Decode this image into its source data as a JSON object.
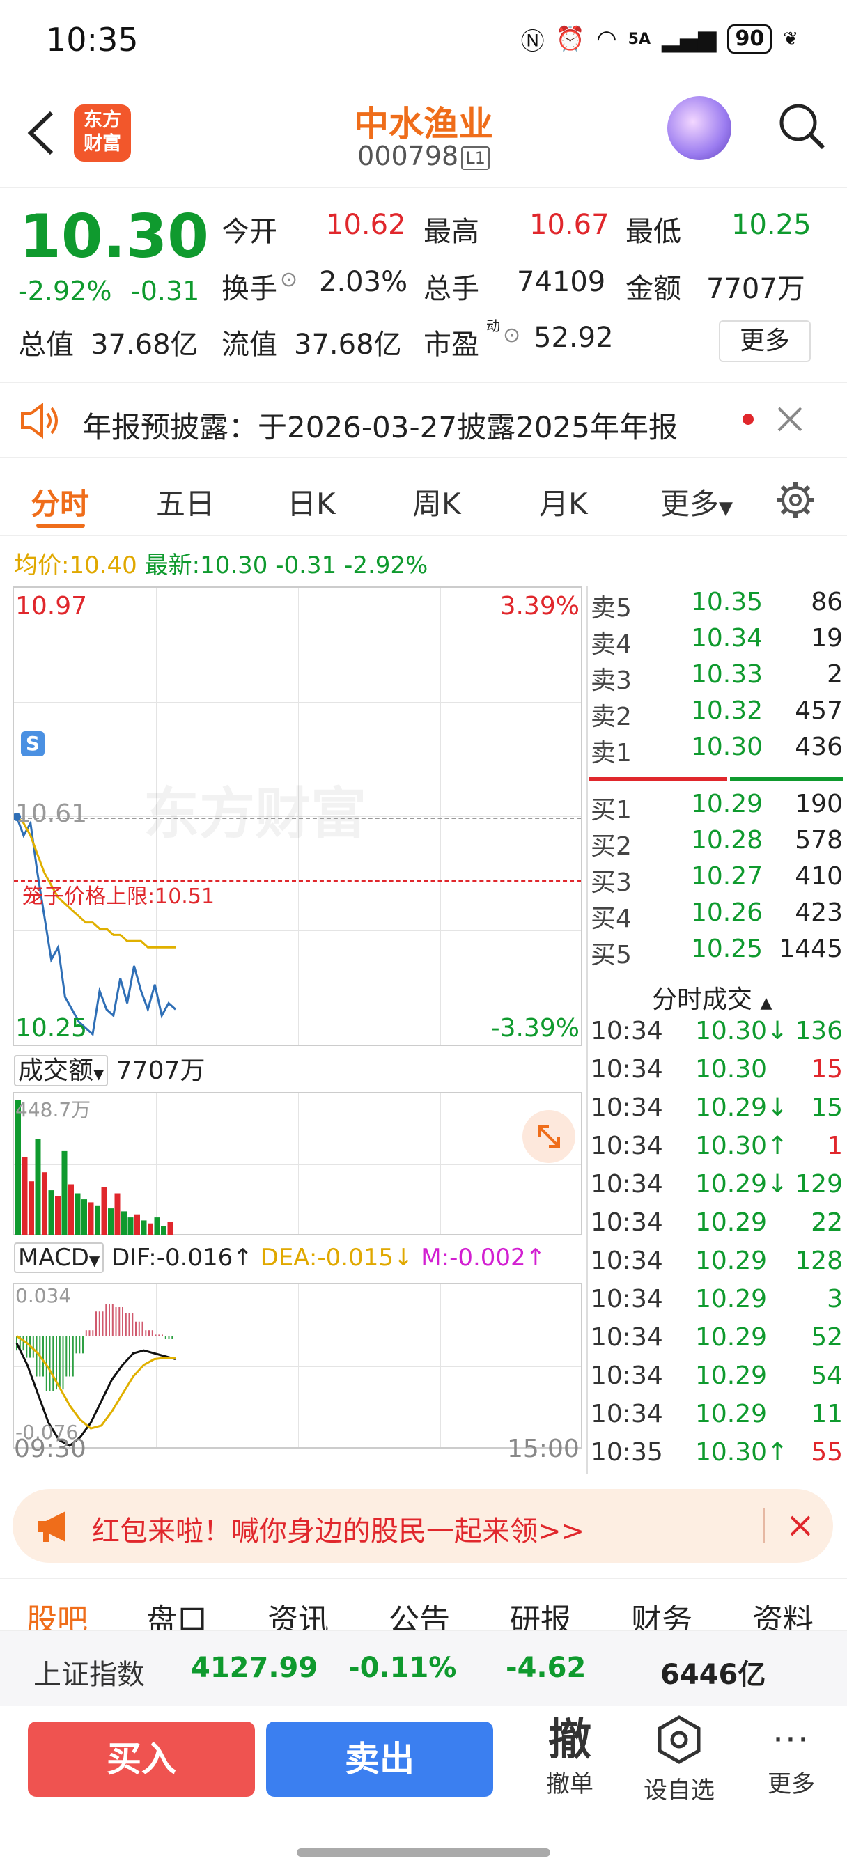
{
  "status": {
    "time": "10:35",
    "network": "5A",
    "battery": "90"
  },
  "header": {
    "logo": "东方财富",
    "name": "中水渔业",
    "code": "000798",
    "level": "L1"
  },
  "quote": {
    "price": "10.30",
    "change_pct": "-2.92%",
    "change": "-0.31",
    "open_label": "今开",
    "open": "10.62",
    "high_label": "最高",
    "high": "10.67",
    "low_label": "最低",
    "low": "10.25",
    "turnover_label": "换手",
    "turnover": "2.03%",
    "volume_label": "总手",
    "volume": "74109",
    "amount_label": "金额",
    "amount": "7707万",
    "mktcap_label": "总值",
    "mktcap": "37.68亿",
    "float_label": "流值",
    "float": "37.68亿",
    "pe_label": "市盈",
    "pe_sup": "动",
    "pe": "52.92",
    "more": "更多"
  },
  "notice": {
    "text": "年报预披露：于2026-03-27披露2025年年报"
  },
  "tabs": [
    "分时",
    "五日",
    "日K",
    "周K",
    "月K",
    "更多"
  ],
  "avg_line": {
    "avg_label": "均价:",
    "avg": "10.40",
    "latest_label": "最新:",
    "latest": "10.30",
    "change": "-0.31",
    "change_pct": "-2.92%"
  },
  "chart": {
    "price_max": "10.97",
    "price_min": "10.25",
    "pct_max": "3.39%",
    "pct_min": "-3.39%",
    "prev_close": "10.61",
    "cage_limit": "笼子价格上限:10.51",
    "watermark": "东方财富",
    "marker": "S",
    "vol_label": "成交额",
    "vol_value": "7707万",
    "vol_max": "448.7万",
    "macd_label": "MACD",
    "dif": "DIF:-0.016↑",
    "dea": "DEA:-0.015↓",
    "m": "M:-0.002↑",
    "macd_max": "0.034",
    "macd_min": "-0.076",
    "time_start": "09:30",
    "time_end": "15:00"
  },
  "chart_data": {
    "type": "line",
    "title": "",
    "ylim": [
      10.25,
      10.97
    ],
    "series": [
      {
        "name": "最新",
        "color": "#2f6fb6",
        "values": [
          10.61,
          10.58,
          10.6,
          10.52,
          10.45,
          10.38,
          10.4,
          10.32,
          10.3,
          10.28,
          10.27,
          10.26,
          10.33,
          10.3,
          10.29,
          10.35,
          10.31,
          10.37,
          10.33,
          10.3,
          10.34,
          10.29,
          10.31,
          10.3
        ]
      },
      {
        "name": "均价",
        "color": "#e0b000",
        "values": [
          10.61,
          10.6,
          10.58,
          10.55,
          10.52,
          10.5,
          10.48,
          10.47,
          10.46,
          10.45,
          10.44,
          10.44,
          10.43,
          10.43,
          10.42,
          10.42,
          10.41,
          10.41,
          10.41,
          10.4,
          10.4,
          10.4,
          10.4,
          10.4
        ]
      }
    ],
    "volume_unit": "万",
    "volume": [
      448.7,
      260,
      180,
      320,
      210,
      150,
      130,
      280,
      170,
      140,
      120,
      110,
      100,
      160,
      90,
      140,
      80,
      60,
      70,
      50,
      40,
      60,
      30,
      45
    ],
    "volume_up": [
      false,
      true,
      true,
      false,
      true,
      false,
      true,
      false,
      true,
      false,
      false,
      true,
      false,
      true,
      false,
      true,
      false,
      false,
      true,
      false,
      true,
      false,
      false,
      true
    ],
    "macd_dif": [
      -0.005,
      -0.02,
      -0.04,
      -0.06,
      -0.072,
      -0.076,
      -0.07,
      -0.06,
      -0.045,
      -0.03,
      -0.02,
      -0.012,
      -0.01,
      -0.012,
      -0.014,
      -0.016
    ],
    "macd_dea": [
      0.0,
      -0.005,
      -0.012,
      -0.022,
      -0.035,
      -0.048,
      -0.058,
      -0.064,
      -0.062,
      -0.052,
      -0.04,
      -0.028,
      -0.02,
      -0.016,
      -0.015,
      -0.015
    ],
    "macd_hist": [
      -0.01,
      -0.015,
      -0.028,
      -0.038,
      -0.037,
      -0.028,
      -0.012,
      0.004,
      0.017,
      0.022,
      0.02,
      0.016,
      0.01,
      0.004,
      0.001,
      -0.002
    ]
  },
  "orderbook": {
    "asks": [
      {
        "label": "卖5",
        "price": "10.35",
        "vol": "86"
      },
      {
        "label": "卖4",
        "price": "10.34",
        "vol": "19"
      },
      {
        "label": "卖3",
        "price": "10.33",
        "vol": "2"
      },
      {
        "label": "卖2",
        "price": "10.32",
        "vol": "457"
      },
      {
        "label": "卖1",
        "price": "10.30",
        "vol": "436"
      }
    ],
    "bids": [
      {
        "label": "买1",
        "price": "10.29",
        "vol": "190"
      },
      {
        "label": "买2",
        "price": "10.28",
        "vol": "578"
      },
      {
        "label": "买3",
        "price": "10.27",
        "vol": "410"
      },
      {
        "label": "买4",
        "price": "10.26",
        "vol": "423"
      },
      {
        "label": "买5",
        "price": "10.25",
        "vol": "1445"
      }
    ],
    "ask_ratio": 0.55
  },
  "trades": {
    "title": "分时成交",
    "rows": [
      {
        "time": "10:34",
        "price": "10.30↓",
        "vol": "136",
        "pc": "green",
        "vc": "green"
      },
      {
        "time": "10:34",
        "price": "10.30",
        "vol": "15",
        "pc": "green",
        "vc": "red"
      },
      {
        "time": "10:34",
        "price": "10.29↓",
        "vol": "15",
        "pc": "green",
        "vc": "green"
      },
      {
        "time": "10:34",
        "price": "10.30↑",
        "vol": "1",
        "pc": "green",
        "vc": "red"
      },
      {
        "time": "10:34",
        "price": "10.29↓",
        "vol": "129",
        "pc": "green",
        "vc": "green"
      },
      {
        "time": "10:34",
        "price": "10.29",
        "vol": "22",
        "pc": "green",
        "vc": "green"
      },
      {
        "time": "10:34",
        "price": "10.29",
        "vol": "128",
        "pc": "green",
        "vc": "green"
      },
      {
        "time": "10:34",
        "price": "10.29",
        "vol": "3",
        "pc": "green",
        "vc": "green"
      },
      {
        "time": "10:34",
        "price": "10.29",
        "vol": "52",
        "pc": "green",
        "vc": "green"
      },
      {
        "time": "10:34",
        "price": "10.29",
        "vol": "54",
        "pc": "green",
        "vc": "green"
      },
      {
        "time": "10:34",
        "price": "10.29",
        "vol": "11",
        "pc": "green",
        "vc": "green"
      },
      {
        "time": "10:35",
        "price": "10.30↑",
        "vol": "55",
        "pc": "green",
        "vc": "red"
      }
    ]
  },
  "promo": {
    "text": "红包来啦！喊你身边的股民一起来领>>"
  },
  "bottom_tabs": [
    "股吧",
    "盘口",
    "资讯",
    "公告",
    "研报",
    "财务",
    "资料"
  ],
  "index_bar": {
    "name": "上证指数",
    "value": "4127.99",
    "pct": "-0.11%",
    "change": "-4.62",
    "amount": "6446亿"
  },
  "actions": {
    "buy": "买入",
    "sell": "卖出",
    "cancel_glyph": "撤",
    "cancel": "撤单",
    "watch": "设自选",
    "more": "更多"
  },
  "colors": {
    "up": "#e0272c",
    "down": "#0f9a2e",
    "brand": "#ef6d1a",
    "buy": "#ef5350",
    "sell": "#3b7ff0"
  }
}
